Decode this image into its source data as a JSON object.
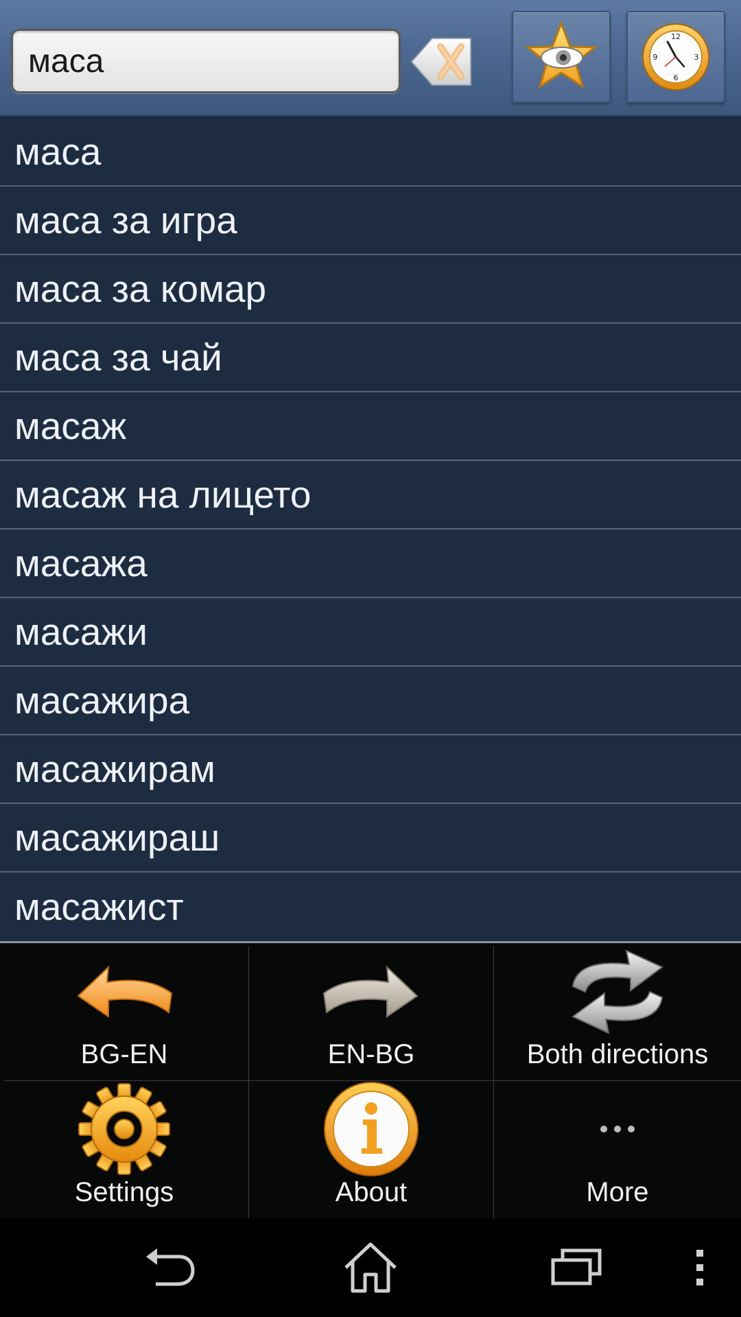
{
  "search": {
    "value": "маса",
    "clear_icon": "clear-x-icon"
  },
  "toolbar": {
    "favorites_icon": "star-eye-icon",
    "history_icon": "clock-icon"
  },
  "words": [
    "маса",
    "маса за игра",
    "маса за комар",
    "маса за чай",
    "масаж",
    "масаж на лицето",
    "масажа",
    "масажи",
    "масажира",
    "масажирам",
    "масажираш",
    "масажист"
  ],
  "menu": {
    "bg_en": "BG-EN",
    "en_bg": "EN-BG",
    "both": "Both directions",
    "settings": "Settings",
    "about": "About",
    "more": "More"
  },
  "nav": {
    "back_icon": "back-icon",
    "home_icon": "home-icon",
    "recents_icon": "recent-apps-icon",
    "overflow_icon": "overflow-menu-icon"
  },
  "colors": {
    "accent": "#f5a623",
    "list_bg": "#1e2c42",
    "header_bg": "#4c6890"
  }
}
